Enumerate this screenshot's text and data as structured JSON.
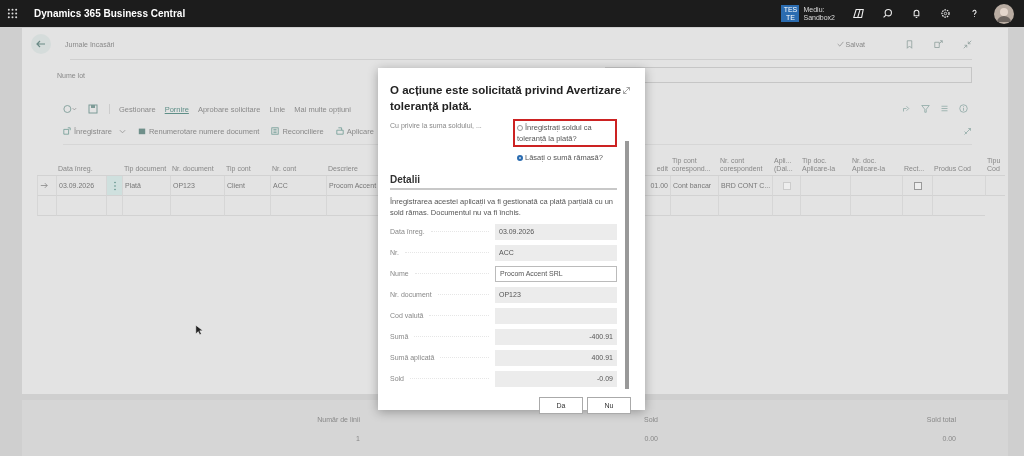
{
  "app_bar": {
    "title": "Dynamics 365 Business Central",
    "badge": "TES TE",
    "environment_label": "Mediu:",
    "environment": "Sandbox2"
  },
  "page": {
    "title": "Jurnale încasări",
    "status": "Salvat",
    "batch_label": "Nume lot",
    "tabs": [
      {
        "label": "Gestionare",
        "selected": false
      },
      {
        "label": "Pornire",
        "selected": true
      },
      {
        "label": "Aprobare solicitare",
        "selected": false
      },
      {
        "label": "Linie",
        "selected": false
      },
      {
        "label": "Mai multe opțiuni",
        "selected": false
      }
    ],
    "actions": [
      {
        "label": "Înregistrare",
        "kind": "post"
      },
      {
        "label": "Renumerotare numere document",
        "kind": "renumber"
      },
      {
        "label": "Reconciliere",
        "kind": "reconcile"
      },
      {
        "label": "Aplicare",
        "kind": "apply"
      }
    ],
    "columns_left": [
      "Data înreg.",
      "Tip document",
      "Nr. document",
      "Tip cont",
      "Nr. cont",
      "Descriere"
    ],
    "column_credit": "edit",
    "columns_right": [
      "Tip cont corespond...",
      "Nr. cont corespondent",
      "Apli... (Dal...",
      "Tip doc. Aplicare-la",
      "Nr. doc. Aplicare-la",
      "Rect...",
      "Produs Cod",
      "Tipu Cod"
    ],
    "row": {
      "date": "03.09.2026",
      "doc_type": "Plată",
      "doc_no": "OP123",
      "account_type": "Client",
      "account_no": "ACC",
      "description": "Procom Accent",
      "credit": "01.00",
      "bal_account_type": "Cont bancar",
      "bal_account_no": "BRD CONT C...",
      "applies_checked": false,
      "correction_checked": false
    },
    "totals": [
      {
        "label": "Număr de linii",
        "value": "1"
      },
      {
        "label": "Sold",
        "value": "0.00"
      },
      {
        "label": "Sold total",
        "value": "0.00"
      }
    ]
  },
  "dialog": {
    "title": "O acțiune este solicitată privind Avertizare toleranță plată.",
    "prompt": "Cu privire la suma soldului, ...",
    "options": [
      {
        "label": "Înregistrați soldul ca toleranță la plată?",
        "selected": false,
        "highlighted": true
      },
      {
        "label": "Lăsați o sumă rămasă?",
        "selected": true,
        "highlighted": false
      }
    ],
    "section": "Detalii",
    "description": "Înregistrarea acestei aplicații va fi gestionată ca plată parțială cu un sold rămas. Documentul nu va fi închis.",
    "fields": [
      {
        "label": "Data înreg.",
        "value": "03.09.2026",
        "editable": false,
        "kind": "text"
      },
      {
        "label": "Nr.",
        "value": "ACC",
        "editable": false,
        "kind": "text"
      },
      {
        "label": "Nume",
        "value": "Procom Accent SRL",
        "editable": true,
        "kind": "text"
      },
      {
        "label": "Nr. document",
        "value": "OP123",
        "editable": false,
        "kind": "text"
      },
      {
        "label": "Cod valută",
        "editable": false,
        "kind": "text"
      },
      {
        "label": "Sumă",
        "value": "-400.91",
        "editable": false,
        "kind": "amount"
      },
      {
        "label": "Sumă aplicată",
        "value": "400.91",
        "editable": false,
        "kind": "amount"
      },
      {
        "label": "Sold",
        "value": "-0.09",
        "editable": false,
        "kind": "amount"
      }
    ],
    "buttons": [
      "Da",
      "Nu"
    ]
  }
}
